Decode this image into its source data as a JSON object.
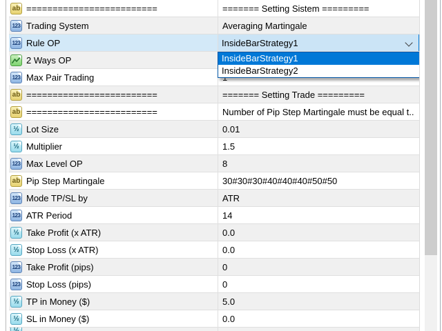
{
  "colors": {
    "selection_bg": "#d3e9f8",
    "combobox_fill": "#cbe4f6",
    "combobox_border": "#0078d7",
    "dropdown_border": "#0055a5",
    "dropdown_highlight_bg": "#0078d7",
    "row_stripe": "#f0f0f0",
    "grid_line": "#dfdfdf",
    "scroll_thumb": "#cdcdcd",
    "scroll_track": "#f1f1f1"
  },
  "icons": {
    "string": "ab",
    "integer": "123",
    "double": "½",
    "enum": "line-chart"
  },
  "rows": [
    {
      "icon": "string",
      "label": "=========================",
      "value": "======= Setting Sistem =========",
      "stripe": false
    },
    {
      "icon": "integer",
      "label": "Trading System",
      "value": "Averaging Martingale",
      "stripe": true
    },
    {
      "icon": "integer",
      "label": "Rule OP",
      "value": "InsideBarStrategy1",
      "stripe": false,
      "selected": true,
      "control": "combobox"
    },
    {
      "icon": "enum",
      "label": "2 Ways OP",
      "value": "",
      "stripe": true
    },
    {
      "icon": "integer",
      "label": "Max Pair Trading",
      "value": "1",
      "stripe": false
    },
    {
      "icon": "string",
      "label": "=========================",
      "value": "======= Setting Trade =========",
      "stripe": true
    },
    {
      "icon": "string",
      "label": "=========================",
      "value": "Number of Pip Step Martingale must be equal t..",
      "stripe": false
    },
    {
      "icon": "double",
      "label": "Lot Size",
      "value": "0.01",
      "stripe": true
    },
    {
      "icon": "double",
      "label": "Multiplier",
      "value": "1.5",
      "stripe": false
    },
    {
      "icon": "integer",
      "label": "Max Level OP",
      "value": "8",
      "stripe": true
    },
    {
      "icon": "string",
      "label": "Pip Step Martingale",
      "value": "30#30#30#40#40#40#50#50",
      "stripe": false
    },
    {
      "icon": "integer",
      "label": "Mode TP/SL by",
      "value": "ATR",
      "stripe": true
    },
    {
      "icon": "integer",
      "label": "ATR Period",
      "value": "14",
      "stripe": false
    },
    {
      "icon": "double",
      "label": "Take Profit (x ATR)",
      "value": "0.0",
      "stripe": true
    },
    {
      "icon": "double",
      "label": "Stop Loss (x ATR)",
      "value": "0.0",
      "stripe": false
    },
    {
      "icon": "integer",
      "label": "Take Profit (pips)",
      "value": "0",
      "stripe": true
    },
    {
      "icon": "integer",
      "label": "Stop Loss (pips)",
      "value": "0",
      "stripe": false
    },
    {
      "icon": "double",
      "label": "TP in Money ($)",
      "value": "5.0",
      "stripe": true
    },
    {
      "icon": "double",
      "label": "SL in Money ($)",
      "value": "0.0",
      "stripe": false
    },
    {
      "icon": "double",
      "label": "",
      "value": "",
      "stripe": true,
      "partial": true
    }
  ],
  "dropdown": {
    "selected_value": "InsideBarStrategy1",
    "options": [
      "InsideBarStrategy1",
      "InsideBarStrategy2"
    ],
    "highlighted_index": 0
  }
}
